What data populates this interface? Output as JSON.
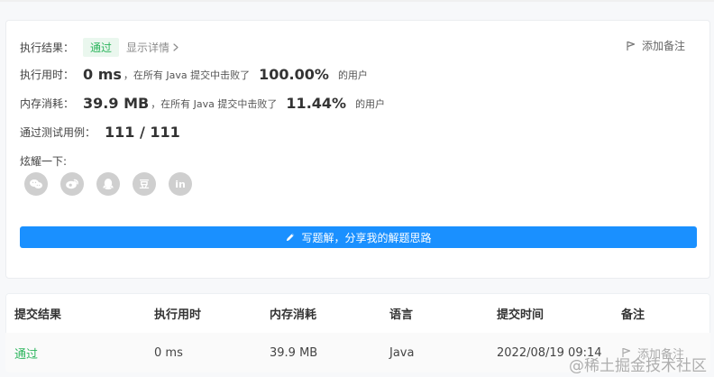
{
  "result": {
    "execution_label": "执行结果：",
    "status": "通过",
    "details": "显示详情",
    "add_note": "添加备注"
  },
  "runtime": {
    "label": "执行用时：",
    "value": "0 ms",
    "middle": "，在所有 Java 提交中击败了",
    "percent": "100.00%",
    "suffix": "的用户"
  },
  "memory": {
    "label": "内存消耗：",
    "value": "39.9 MB",
    "middle": "，在所有 Java 提交中击败了",
    "percent": "11.44%",
    "suffix": "的用户"
  },
  "tests": {
    "label": "通过测试用例：",
    "value": "111 / 111"
  },
  "share": {
    "label": "炫耀一下:",
    "douban": "豆",
    "linkedin": "in"
  },
  "write_solution": "写题解，分享我的解题思路",
  "table": {
    "headers": [
      "提交结果",
      "执行用时",
      "内存消耗",
      "语言",
      "提交时间",
      "备注"
    ],
    "row": {
      "result": "通过",
      "runtime": "0 ms",
      "memory": "39.9 MB",
      "language": "Java",
      "submitted": "2022/08/19 09:14",
      "note": "添加备注"
    }
  },
  "watermark": "@稀土掘金技术社区",
  "colors": {
    "success": "#2db55d",
    "primary": "#1a90ff",
    "share_icon_bg": "#cfcfcf"
  }
}
